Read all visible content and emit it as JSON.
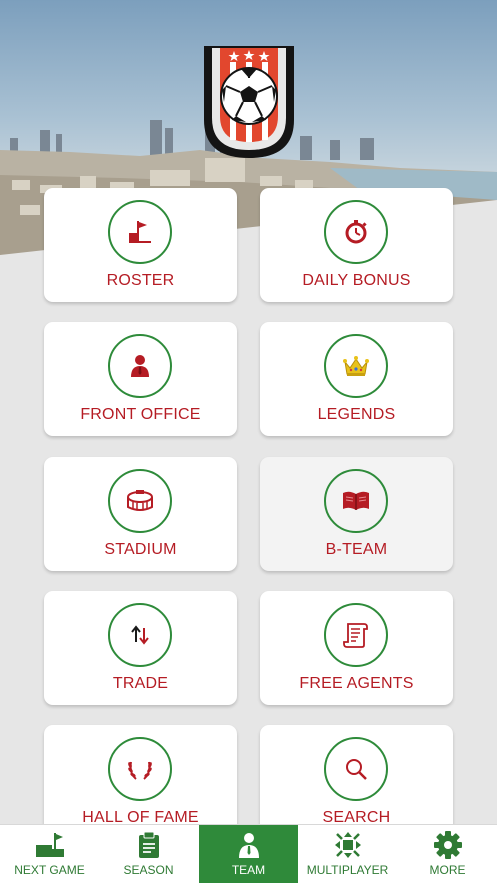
{
  "tiles": [
    {
      "label": "ROSTER",
      "icon": "corner-flag-icon"
    },
    {
      "label": "DAILY BONUS",
      "icon": "stopwatch-icon"
    },
    {
      "label": "FRONT OFFICE",
      "icon": "manager-icon"
    },
    {
      "label": "LEGENDS",
      "icon": "crown-icon"
    },
    {
      "label": "STADIUM",
      "icon": "stadium-icon"
    },
    {
      "label": "B-TEAM",
      "icon": "open-book-icon"
    },
    {
      "label": "TRADE",
      "icon": "swap-arrows-icon"
    },
    {
      "label": "FREE AGENTS",
      "icon": "contract-scroll-icon"
    },
    {
      "label": "HALL OF FAME",
      "icon": "laurel-wreath-icon"
    },
    {
      "label": "SEARCH",
      "icon": "magnifier-icon"
    }
  ],
  "tabs": [
    {
      "label": "NEXT GAME",
      "icon": "pitch-flag-icon"
    },
    {
      "label": "SEASON",
      "icon": "clipboard-icon"
    },
    {
      "label": "TEAM",
      "icon": "player-icon",
      "active": true
    },
    {
      "label": "MULTIPLAYER",
      "icon": "arrows-in-icon"
    },
    {
      "label": "MORE",
      "icon": "gear-icon"
    }
  ],
  "colors": {
    "accent_red": "#b51c24",
    "accent_green": "#2e8b3a",
    "active_tab": "#2f8a3a"
  }
}
